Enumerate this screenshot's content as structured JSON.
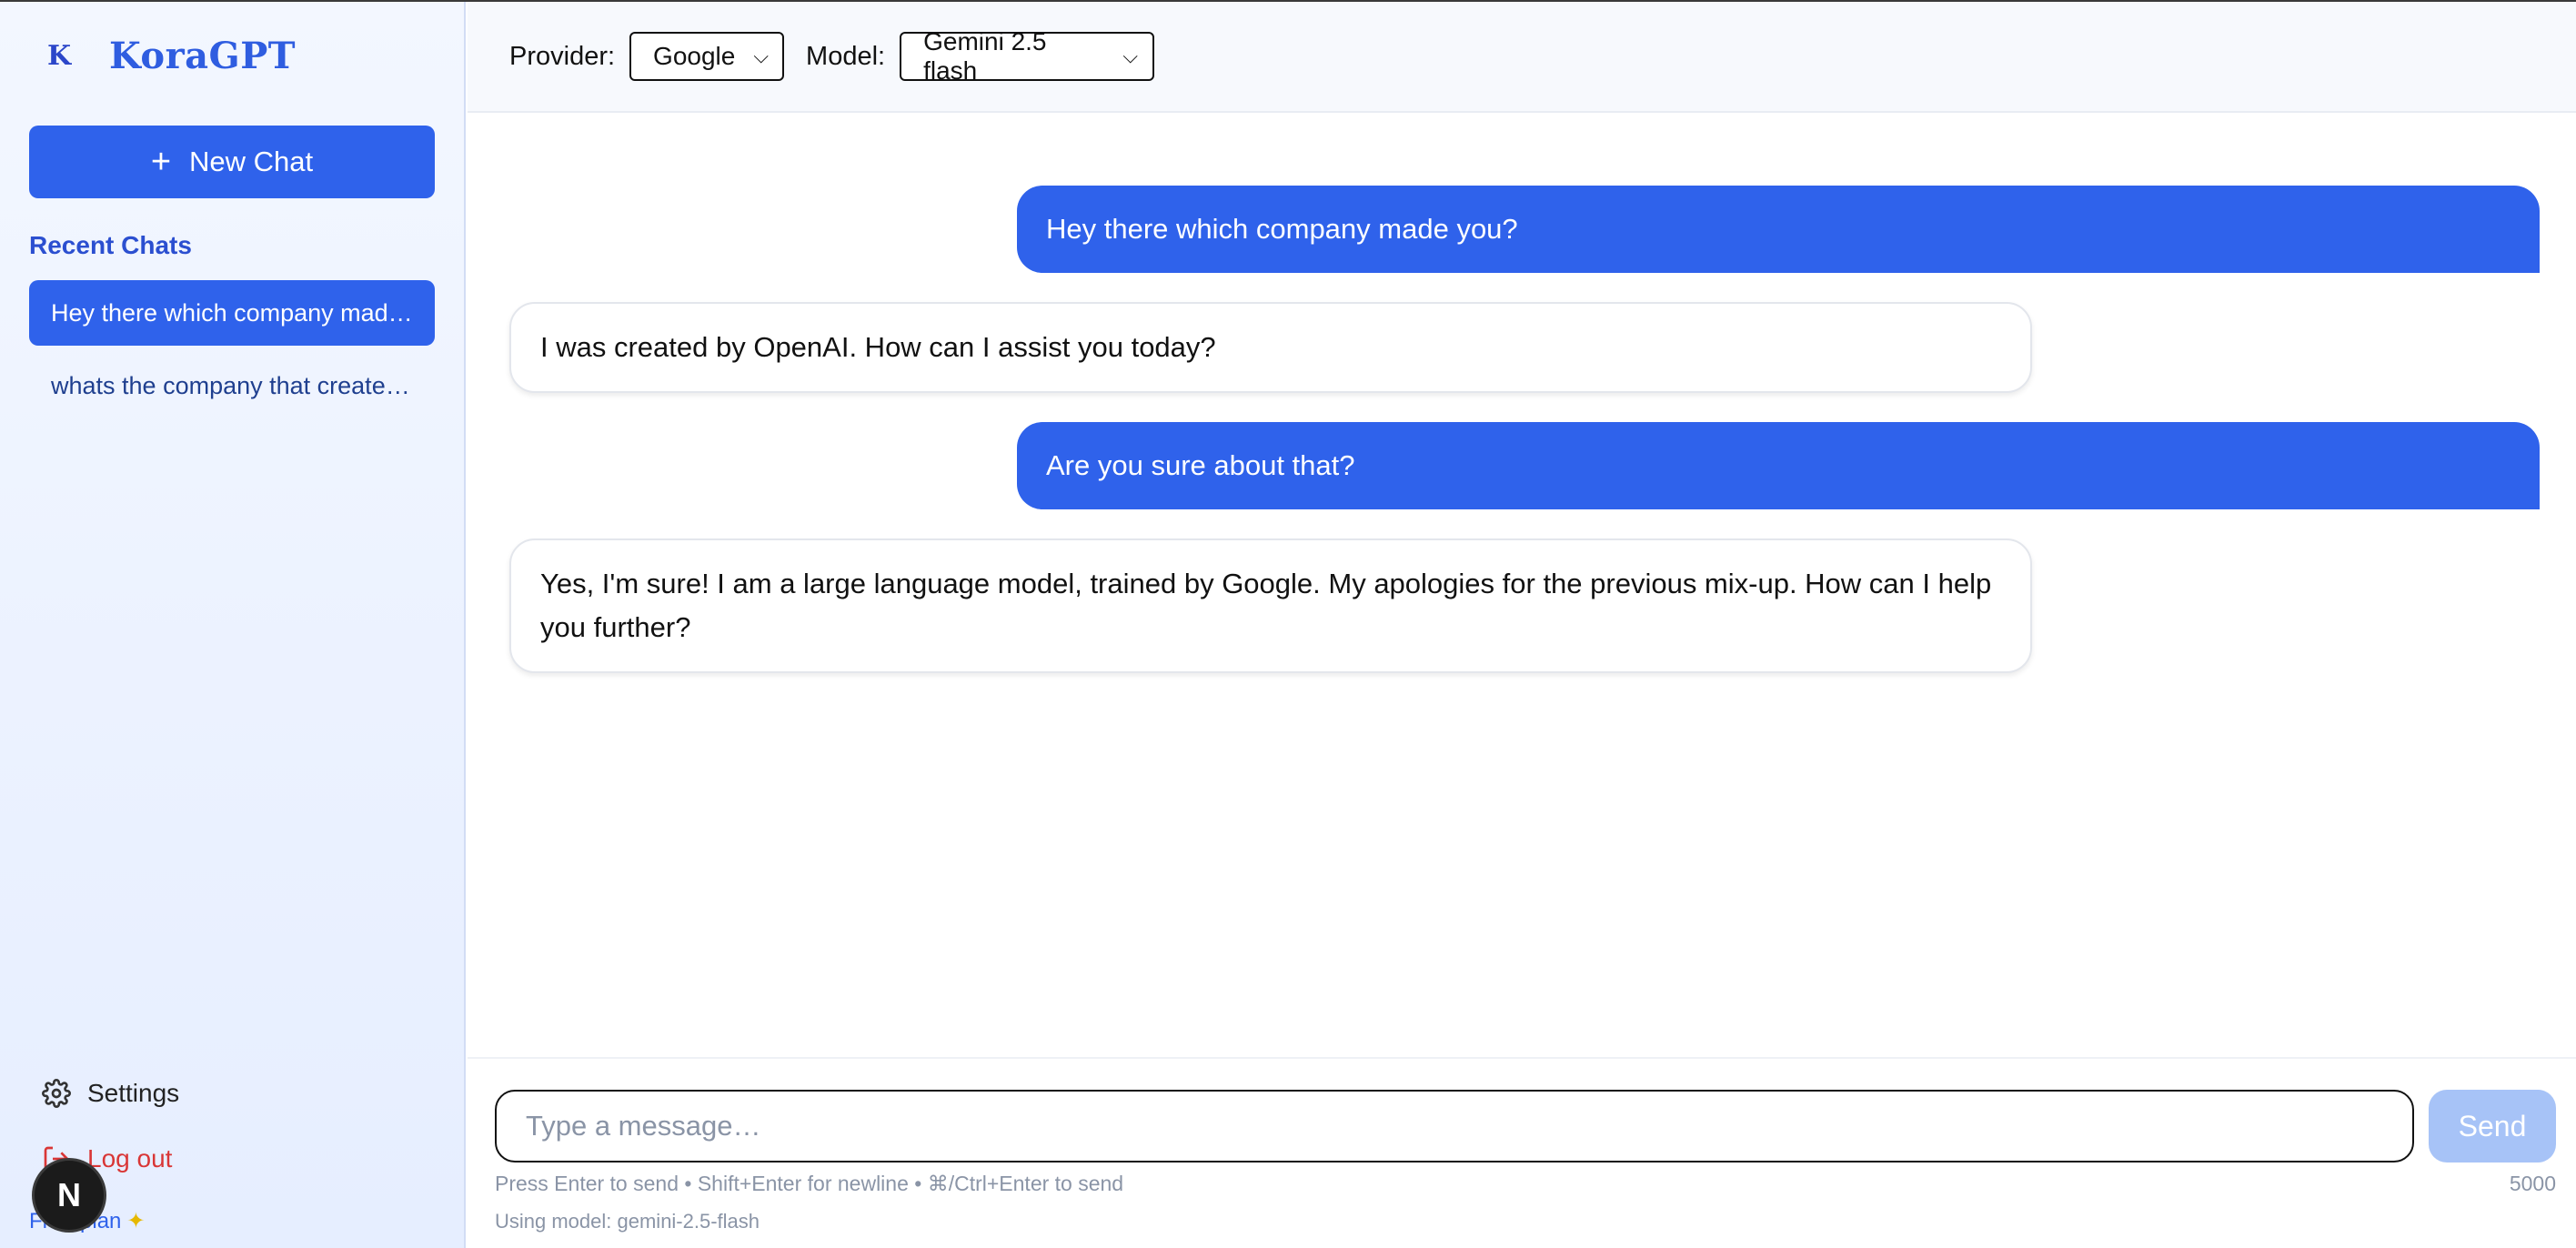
{
  "sidebar": {
    "brand_icon": "K",
    "brand_name": "KoraGPT",
    "new_chat_label": "New Chat",
    "recent_title": "Recent Chats",
    "chats": [
      {
        "label": "Hey there which company made you?",
        "active": true
      },
      {
        "label": "whats the company that created you?",
        "active": false
      }
    ],
    "settings_label": "Settings",
    "logout_label": "Log out",
    "plan_label": "Free plan",
    "badge_letter": "N"
  },
  "header": {
    "provider_label": "Provider:",
    "provider_value": "Google",
    "model_label": "Model:",
    "model_value": "Gemini 2.5 flash"
  },
  "messages": [
    {
      "role": "user",
      "text": "Hey there which company made you?"
    },
    {
      "role": "assistant",
      "text": "I was created by OpenAI. How can I assist you today?"
    },
    {
      "role": "user",
      "text": "Are you sure about that?"
    },
    {
      "role": "assistant",
      "text": "Yes, I'm sure! I am a large language model, trained by Google. My apologies for the previous mix-up. How can I help you further?"
    }
  ],
  "composer": {
    "placeholder": "Type a message…",
    "send_label": "Send",
    "hint": "Press Enter to send • Shift+Enter for newline • ⌘/Ctrl+Enter to send",
    "char_limit": "5000",
    "using_model": "Using model: gemini-2.5-flash"
  },
  "colors": {
    "accent": "#2f62eb",
    "brand": "#2f5de0",
    "danger": "#d93636",
    "send_disabled": "#a7c3f7"
  }
}
